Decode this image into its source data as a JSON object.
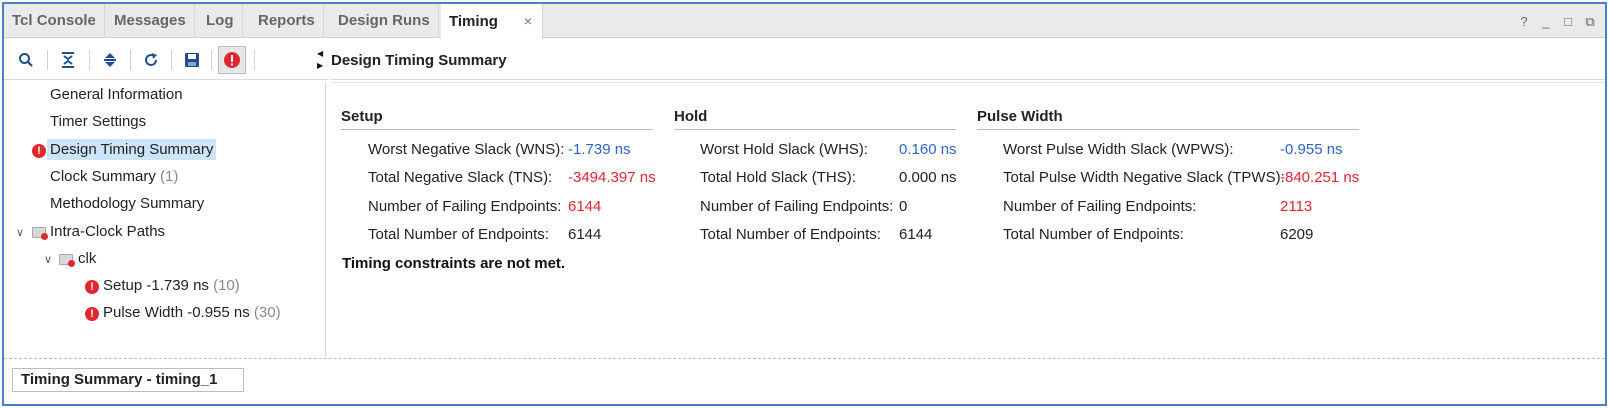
{
  "tabs": [
    {
      "label": "Tcl Console"
    },
    {
      "label": "Messages"
    },
    {
      "label": "Log"
    },
    {
      "label": "Reports"
    },
    {
      "label": "Design Runs"
    },
    {
      "label": "Timing",
      "active": true,
      "close": "×"
    }
  ],
  "window_controls": {
    "help": "?",
    "minimize": "_",
    "restore": "□",
    "popout": "⧉"
  },
  "toolbar": {
    "icons": [
      "search-icon",
      "collapse-all-icon",
      "expand-all-icon",
      "refresh-icon",
      "save-icon",
      "error-filter-icon"
    ]
  },
  "tree": {
    "items": [
      {
        "label": "General Information"
      },
      {
        "label": "Timer Settings"
      },
      {
        "label": "Design Timing Summary",
        "selected": true,
        "error": true
      },
      {
        "label": "Clock Summary",
        "count": "(1)"
      },
      {
        "label": "Methodology Summary"
      },
      {
        "label": "Intra-Clock Paths"
      },
      {
        "label": "clk"
      },
      {
        "label": "Setup -1.739 ns",
        "count": "(10)",
        "error": true
      },
      {
        "label": "Pulse Width -0.955 ns",
        "count": "(30)",
        "error": true
      }
    ]
  },
  "panel": {
    "title": "Design Timing Summary",
    "setup": {
      "title": "Setup",
      "rows": [
        {
          "label": "Worst Negative Slack (WNS):",
          "value": "-1.739 ns"
        },
        {
          "label": "Total Negative Slack (TNS):",
          "value": "-3494.397 ns"
        },
        {
          "label": "Number of Failing Endpoints:",
          "value": "6144"
        },
        {
          "label": "Total Number of Endpoints:",
          "value": "6144"
        }
      ]
    },
    "hold": {
      "title": "Hold",
      "rows": [
        {
          "label": "Worst Hold Slack (WHS):",
          "value": "0.160 ns"
        },
        {
          "label": "Total Hold Slack (THS):",
          "value": "0.000 ns"
        },
        {
          "label": "Number of Failing Endpoints:",
          "value": "0"
        },
        {
          "label": "Total Number of Endpoints:",
          "value": "6144"
        }
      ]
    },
    "pulse": {
      "title": "Pulse Width",
      "rows": [
        {
          "label": "Worst Pulse Width Slack (WPWS):",
          "value": "-0.955 ns"
        },
        {
          "label": "Total Pulse Width Negative Slack (TPWS):",
          "value": "-840.251 ns"
        },
        {
          "label": "Number of Failing Endpoints:",
          "value": "2113"
        },
        {
          "label": "Total Number of Endpoints:",
          "value": "6209"
        }
      ]
    },
    "status": "Timing constraints are not met."
  },
  "bottom_tab": {
    "label": "Timing Summary - timing_1"
  },
  "colors": {
    "accent_border": "#4a7ec8",
    "blue_value": "#2e63c9",
    "red_value": "#e0262f",
    "selection": "#cde3f7"
  }
}
